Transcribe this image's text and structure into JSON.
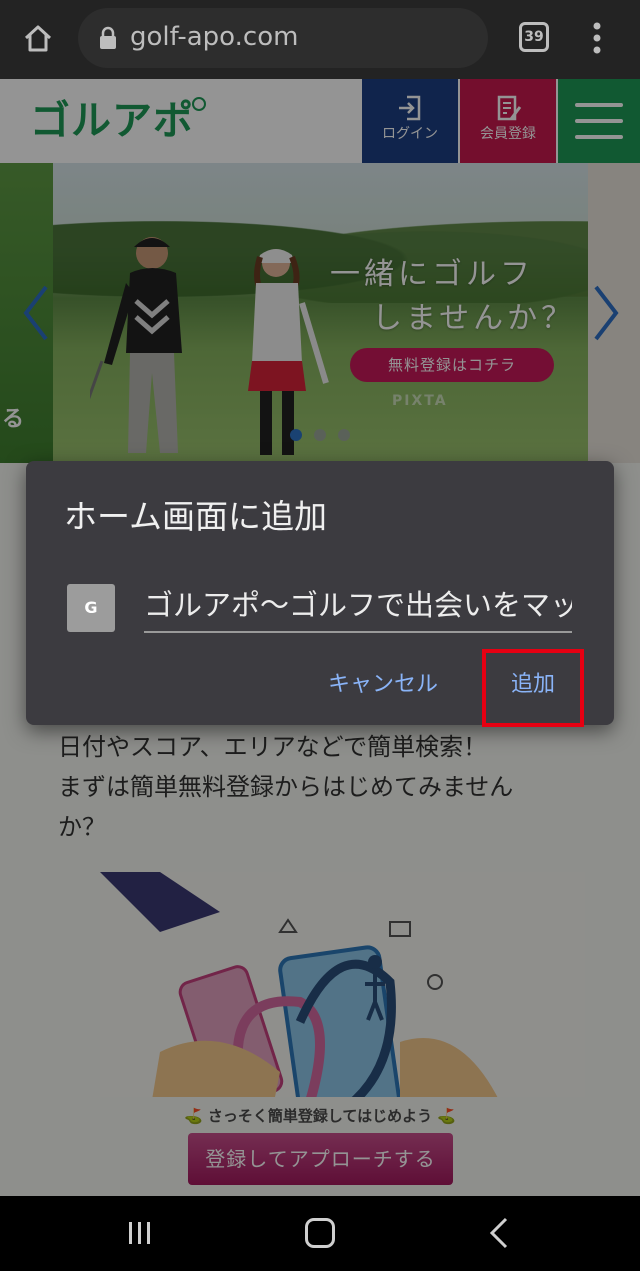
{
  "browser": {
    "url": "golf-apo.com",
    "tab_count": "39"
  },
  "site": {
    "logo": "ゴルアポ",
    "login_label": "ログイン",
    "register_label": "会員登録",
    "hero": {
      "copy_line1": "一緒にゴルフ",
      "copy_line2": "しませんか？",
      "cta": "無料登録はコチラ",
      "watermark": "PIXTA",
      "left_peek_text": "る",
      "slides_count": 3,
      "active_slide": 1
    },
    "body_text_line1": "日付やスコア、エリアなどで簡単検索！",
    "body_text_line2": "まずは簡単無料登録からはじめてみません",
    "body_text_line3": "か？",
    "bottom_message": "さっそく簡単登録してはじめよう",
    "bottom_button": "登録してアプローチする"
  },
  "dialog": {
    "title": "ホーム画面に追加",
    "favicon_letter": "G",
    "shortcut_name": "ゴルアポ〜ゴルフで出会いをマッ",
    "cancel_label": "キャンセル",
    "add_label": "追加"
  },
  "colors": {
    "brand_green": "#1e9a57",
    "login_blue": "#1c3f83",
    "register_pink": "#c8194f",
    "dialog_bg": "#3c3b40",
    "dialog_action": "#8ab4f8",
    "highlight_red": "#e60012"
  }
}
